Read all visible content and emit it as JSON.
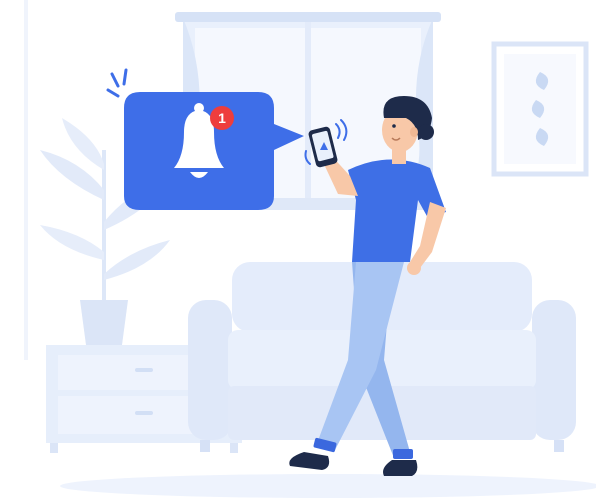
{
  "illustration": {
    "notification": {
      "badge_count": "1"
    },
    "icons": {
      "bell": "bell-icon",
      "phone_alert": "warning-icon"
    },
    "colors": {
      "accent": "#3e6ee8",
      "badge": "#ee3d3d",
      "shirt": "#3e6fe6",
      "pants": "#9dbdf0",
      "background_shapes": "#e7effc",
      "hair": "#1e2b4a"
    }
  }
}
